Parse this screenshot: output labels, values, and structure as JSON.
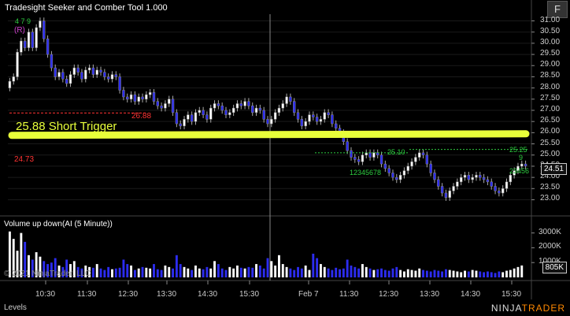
{
  "window": {
    "title": "Tradesight Seeker and Comber Tool 1.000",
    "f_button": "F"
  },
  "price_axis": [
    "31.00",
    "30.50",
    "30.00",
    "29.50",
    "29.00",
    "28.50",
    "28.00",
    "27.50",
    "27.00",
    "26.50",
    "26.00",
    "25.50",
    "25.00",
    "24.50",
    "24.00",
    "23.50",
    "23.00"
  ],
  "volume_axis": [
    "3000K",
    "2000K",
    "1000K"
  ],
  "time_axis": [
    "10:30",
    "11:30",
    "12:30",
    "13:30",
    "14:30",
    "15:30",
    "Feb 7",
    "11:30",
    "12:30",
    "13:30",
    "14:30",
    "15:30"
  ],
  "current_price": "24.51",
  "current_volume": "805K",
  "annotations": {
    "short_trigger": "25.88 Short Trigger",
    "red_level_left": "24.73",
    "red_level_mid": "26.88",
    "green_level_a": "25.10",
    "green_level_b": "25.25",
    "seeker_r": "(R)",
    "seeker_top": "4  7 9",
    "counts_mid": "12345678",
    "counts_right": "23456",
    "count_9": "9"
  },
  "volume_panel": {
    "label": "Volume up down(AI (5 Minute))"
  },
  "copyright": "© 2021 NinjaTrader, LLC",
  "bottom_tab": "Levels",
  "brand": {
    "ninja": "NINJA",
    "trader": "TRADER"
  },
  "colors": {
    "up_bar": "#ffffff",
    "down_bar": "#2c2cf0",
    "trigger_line": "#e8ff3a",
    "red": "#ff3333",
    "green": "#2ecc40"
  },
  "chart_data": {
    "type": "candlestick",
    "close_series": [
      28.3,
      28.5,
      29.6,
      30.1,
      29.8,
      30.5,
      29.8,
      30.7,
      31.0,
      30.2,
      29.5,
      28.9,
      28.5,
      28.7,
      28.4,
      28.2,
      28.6,
      28.9,
      28.7,
      28.4,
      28.8,
      28.9,
      28.6,
      28.8,
      28.7,
      28.5,
      28.4,
      28.6,
      28.5,
      27.9,
      27.6,
      27.5,
      27.7,
      27.4,
      27.6,
      27.5,
      27.7,
      27.8,
      27.4,
      27.2,
      27.1,
      27.3,
      27.5,
      26.9,
      26.4,
      26.3,
      26.6,
      26.8,
      26.5,
      26.9,
      27.0,
      26.8,
      26.6,
      27.1,
      27.3,
      27.2,
      27.0,
      26.8,
      26.9,
      27.1,
      27.3,
      27.2,
      27.4,
      27.2,
      26.9,
      27.1,
      27.0,
      26.6,
      26.4,
      26.6,
      26.9,
      27.1,
      27.3,
      27.6,
      27.4,
      26.9,
      26.6,
      26.3,
      26.5,
      26.8,
      26.7,
      26.5,
      26.6,
      26.9,
      26.8,
      26.4,
      26.2,
      26.0,
      25.6,
      25.2,
      24.9,
      24.8,
      24.7,
      25.0,
      25.1,
      24.9,
      25.1,
      25.0,
      24.6,
      24.4,
      24.2,
      24.0,
      23.9,
      24.1,
      24.3,
      24.5,
      24.7,
      24.9,
      25.1,
      25.0,
      24.6,
      24.2,
      23.9,
      23.6,
      23.3,
      23.1,
      23.4,
      23.6,
      23.8,
      24.0,
      24.1,
      23.9,
      24.0,
      24.1,
      24.0,
      23.9,
      23.8,
      23.6,
      23.4,
      23.3,
      23.5,
      23.8,
      24.1,
      24.3,
      24.5,
      24.6,
      24.51
    ],
    "volume_series_k": [
      3100,
      2600,
      1800,
      3000,
      2400,
      1500,
      1200,
      1700,
      1400,
      1100,
      900,
      1000,
      1300,
      800,
      700,
      1200,
      900,
      1100,
      700,
      600,
      800,
      700,
      650,
      900,
      600,
      500,
      700,
      550,
      600,
      650,
      1200,
      900,
      800,
      500,
      600,
      700,
      650,
      600,
      900,
      550,
      500,
      800,
      700,
      600,
      1500,
      900,
      700,
      600,
      500,
      800,
      600,
      550,
      700,
      600,
      1100,
      900,
      600,
      500,
      700,
      600,
      800,
      650,
      600,
      700,
      650,
      900,
      800,
      600,
      1300,
      1100,
      800,
      1500,
      900,
      700,
      600,
      500,
      700,
      600,
      800,
      500,
      1600,
      1300,
      900,
      700,
      600,
      500,
      650,
      550,
      600,
      1200,
      800,
      700,
      600,
      900,
      700,
      600,
      500,
      550,
      600,
      500,
      450,
      600,
      700,
      500,
      400,
      550,
      500,
      450,
      600,
      500,
      450,
      400,
      500,
      450,
      400,
      550,
      500,
      450,
      400,
      350,
      450,
      400,
      500,
      450,
      400,
      350,
      400,
      350,
      300,
      400,
      350,
      450,
      500,
      600,
      700,
      805
    ],
    "levels": {
      "short_trigger": 25.88,
      "red_left": 24.73,
      "red_mid": 26.88,
      "green_a": 25.1,
      "green_b": 25.25
    },
    "ylim": [
      22.7,
      31.3
    ],
    "volume_ylim_k": [
      0,
      3300
    ]
  }
}
